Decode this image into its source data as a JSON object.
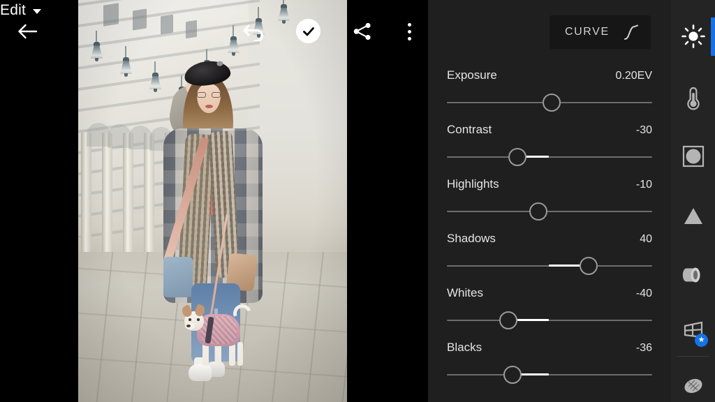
{
  "app": {
    "screen_title": "Edit",
    "theme": {
      "panel_bg": "#1f1f1f",
      "rail_bg": "#242424",
      "accent": "#1473e6",
      "track": "#6d6d6d",
      "fill": "#ffffff"
    }
  },
  "topbar": {
    "back_icon": "back-arrow-icon",
    "title": "Edit",
    "title_caret_icon": "chevron-down-icon",
    "undo_icon": "undo-icon",
    "confirm_icon": "checkmark-icon",
    "share_icon": "share-icon",
    "overflow_icon": "more-vertical-icon"
  },
  "panel": {
    "curve": {
      "label": "CURVE",
      "icon": "tone-curve-icon"
    },
    "sliders": [
      {
        "name": "Exposure",
        "value": "0.20EV",
        "thumb_pct": 51.0,
        "fill_from_pct": null,
        "fill_to_pct": null
      },
      {
        "name": "Contrast",
        "value": "-30",
        "thumb_pct": 34.5,
        "fill_from_pct": 34.5,
        "fill_to_pct": 49.5
      },
      {
        "name": "Highlights",
        "value": "-10",
        "thumb_pct": 44.5,
        "fill_from_pct": null,
        "fill_to_pct": null
      },
      {
        "name": "Shadows",
        "value": "40",
        "thumb_pct": 69.0,
        "fill_from_pct": 49.5,
        "fill_to_pct": 69.0
      },
      {
        "name": "Whites",
        "value": "-40",
        "thumb_pct": 30.0,
        "fill_from_pct": 30.0,
        "fill_to_pct": 49.5
      },
      {
        "name": "Blacks",
        "value": "-36",
        "thumb_pct": 32.0,
        "fill_from_pct": 32.0,
        "fill_to_pct": 49.5
      }
    ]
  },
  "rail": {
    "items": [
      {
        "icon": "light-sun-icon",
        "active": true,
        "badge": null
      },
      {
        "icon": "color-thermometer-icon",
        "active": false,
        "badge": null
      },
      {
        "icon": "effects-vignette-icon",
        "active": false,
        "badge": null
      },
      {
        "icon": "detail-triangle-icon",
        "active": false,
        "badge": null
      },
      {
        "icon": "optics-lens-icon",
        "active": false,
        "badge": null
      },
      {
        "icon": "geometry-perspective-icon",
        "active": false,
        "badge": "premium-star-icon"
      },
      {
        "icon": "healing-brush-icon",
        "active": false,
        "badge": null
      }
    ]
  },
  "photo": {
    "description": "woman-with-dog-street-photo",
    "alt": "Woman in black beret and plaid coat standing with small dog in pink sweater under arcade with hanging lanterns"
  }
}
